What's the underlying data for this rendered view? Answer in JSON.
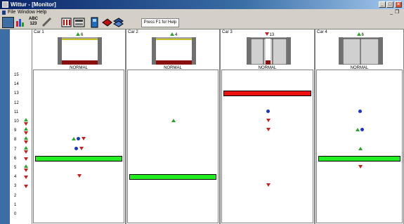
{
  "window": {
    "title": "Wittur - [Monitor]"
  },
  "menu": [
    "File",
    "Window",
    "Help"
  ],
  "toolbar": {
    "abc_label": "ABC",
    "abc_num": "123",
    "help_text": "Press F1 for Help"
  },
  "floors": [
    {
      "num": "15",
      "call": ""
    },
    {
      "num": "14",
      "call": ""
    },
    {
      "num": "13",
      "call": ""
    },
    {
      "num": "12",
      "call": ""
    },
    {
      "num": "11",
      "call": ""
    },
    {
      "num": "10",
      "call": "both"
    },
    {
      "num": "9",
      "call": "both"
    },
    {
      "num": "8",
      "call": "both"
    },
    {
      "num": "7",
      "call": "both"
    },
    {
      "num": "6",
      "call": "down"
    },
    {
      "num": "5",
      "call": "both"
    },
    {
      "num": "4",
      "call": "down"
    },
    {
      "num": "3",
      "call": "down"
    },
    {
      "num": "2",
      "call": ""
    },
    {
      "num": "1",
      "call": ""
    },
    {
      "num": "0",
      "call": ""
    }
  ],
  "cars": [
    {
      "label": "Car 1",
      "position_floor": "6",
      "direction": "up",
      "status": "NORMAL",
      "door": "open",
      "car_floor": 6,
      "bar_color": "#22ee22",
      "markers": [
        {
          "floor": 8,
          "items": [
            "up",
            "dot",
            "down"
          ]
        },
        {
          "floor": 7,
          "items": [
            "dot",
            "down"
          ]
        },
        {
          "floor": 4,
          "items": [
            "down"
          ]
        }
      ]
    },
    {
      "label": "Car 2",
      "position_floor": "4",
      "direction": "up",
      "status": "NORMAL",
      "door": "open",
      "car_floor": 4,
      "bar_color": "#22ee22",
      "markers": [
        {
          "floor": 10,
          "items": [
            "up"
          ]
        }
      ]
    },
    {
      "label": "Car 3",
      "position_floor": "13",
      "direction": "down",
      "status": "NORMAL",
      "door": "closing",
      "car_floor": 13,
      "bar_color": "#ee1111",
      "markers": [
        {
          "floor": 11,
          "items": [
            "dot"
          ]
        },
        {
          "floor": 10,
          "items": [
            "down"
          ]
        },
        {
          "floor": 9,
          "items": [
            "down"
          ]
        },
        {
          "floor": 3,
          "items": [
            "down"
          ]
        }
      ]
    },
    {
      "label": "Car 4",
      "position_floor": "6",
      "direction": "up",
      "status": "NORMAL",
      "door": "closed",
      "car_floor": 6,
      "bar_color": "#22ee22",
      "markers": [
        {
          "floor": 11,
          "items": [
            "dot"
          ]
        },
        {
          "floor": 9,
          "items": [
            "up",
            "dot"
          ]
        },
        {
          "floor": 7,
          "items": [
            "up"
          ]
        },
        {
          "floor": 5,
          "items": [
            "down"
          ]
        }
      ]
    }
  ]
}
